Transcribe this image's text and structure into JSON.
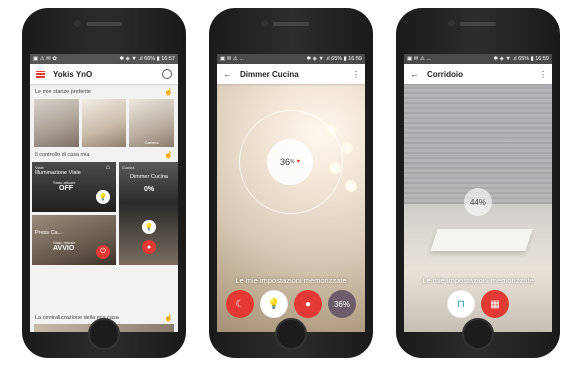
{
  "phone1": {
    "status_left": "▣ ⚠ ✉ ✿",
    "status_right": "✱ ◈ ▼ .ıl 66% ▮ 16:57",
    "app_title": "Yokis YnO",
    "favorites_heading": "Le mie stanze preferite",
    "rooms": [
      {
        "label": ""
      },
      {
        "label": ""
      },
      {
        "label": "Camera"
      }
    ],
    "control_heading": "Il controllo di casa mia",
    "tile_viale": {
      "small": "Viale",
      "name": "Illuminazione Viale",
      "state_label": "Stato attuale",
      "state_value": "OFF"
    },
    "tile_cucina": {
      "small": "Cucina",
      "name": "Dimmer Cucina",
      "value": "0%"
    },
    "tile_scenario": {
      "name": "Press Ca...",
      "state_label": "Stato attuale",
      "state_value": "AVVIO"
    },
    "central_heading": "La centralizzazione della mia casa"
  },
  "phone2": {
    "status_left": "▣ ✉ ⚠ ...",
    "status_right": "✱ ◈ ▼ .ıl 65% ▮ 16:59",
    "title": "Dimmer Cucina",
    "dimmer_value": "36",
    "dimmer_unit": "%",
    "presets_title": "Le mie impostazioni memorizzate",
    "preset_last_value": "36%"
  },
  "phone3": {
    "status_left": "▣ ✉ ⚠ ...",
    "status_right": "✱ ◈ ▼ .ıl 65% ▮ 16:59",
    "title": "Corridoio",
    "position_value": "44%",
    "presets_title": "Le mie impostazioni memorizzate"
  }
}
